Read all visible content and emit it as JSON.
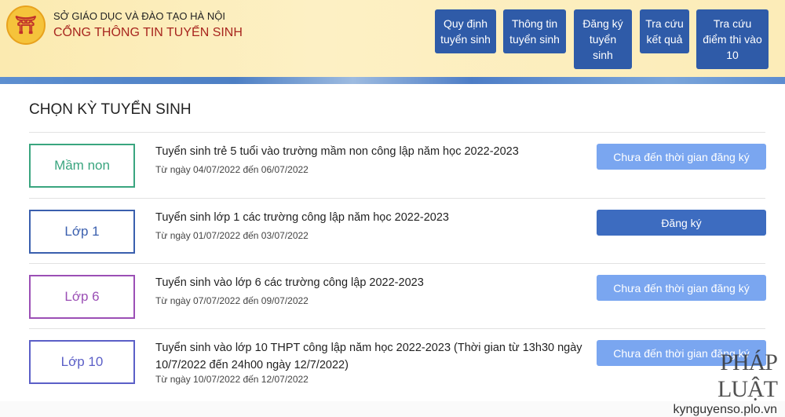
{
  "header": {
    "org": "SỞ GIÁO DỤC VÀ ĐÀO TẠO HÀ NỘI",
    "portal": "CỔNG THÔNG TIN TUYỂN SINH",
    "nav": [
      "Quy định tuyển sinh",
      "Thông tin tuyển sinh",
      "Đăng ký tuyển sinh",
      "Tra cứu kết quả",
      "Tra cứu điểm thi vào 10"
    ]
  },
  "main": {
    "title": "CHỌN KỲ TUYỂN SINH",
    "rows": [
      {
        "level": "Mầm non",
        "color": "#3aa57f",
        "title": "Tuyển sinh trẻ 5 tuổi vào trường mầm non công lập năm học 2022-2023",
        "date": "Từ ngày 04/07/2022 đến 06/07/2022",
        "button": "Chưa đến thời gian đăng ký",
        "enabled": false
      },
      {
        "level": "Lớp 1",
        "color": "#3a5fae",
        "title": "Tuyển sinh lớp 1 các trường công lập năm học 2022-2023",
        "date": "Từ ngày 01/07/2022 đến 03/07/2022",
        "button": "Đăng ký",
        "enabled": true
      },
      {
        "level": "Lớp 6",
        "color": "#9b4fb5",
        "title": "Tuyển sinh vào lớp 6 các trường công lập 2022-2023",
        "date": "Từ ngày 07/07/2022 đến 09/07/2022",
        "button": "Chưa đến thời gian đăng ký",
        "enabled": false
      },
      {
        "level": "Lớp 10",
        "color": "#5b5fc7",
        "title": "Tuyển sinh vào lớp 10 THPT công lập năm học 2022-2023 (Thời gian từ 13h30 ngày 10/7/2022 đến 24h00 ngày 12/7/2022)",
        "date": "Từ ngày 10/07/2022 đến 12/07/2022",
        "button": "Chưa đến thời gian đăng ký",
        "enabled": false
      }
    ]
  },
  "colors": {
    "nav": "#2f5ba8",
    "button_enabled": "#3d6cc0",
    "button_disabled": "#7aa6f0"
  },
  "watermark": {
    "brand": "PHÁP LUẬT",
    "site": "kynguyenso.plo.vn"
  }
}
